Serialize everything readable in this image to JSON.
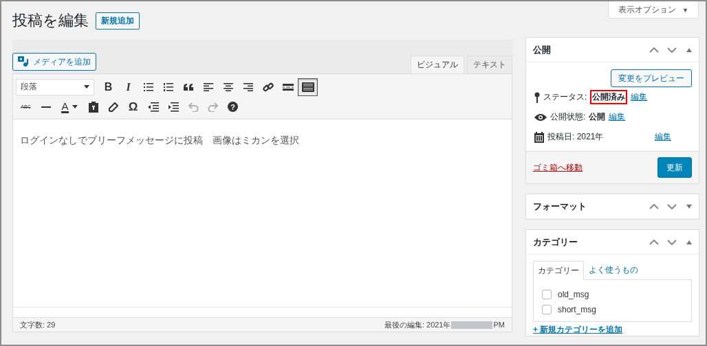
{
  "screen_options": {
    "label": "表示オプション",
    "caret": "▼"
  },
  "heading": {
    "title": "投稿を編集",
    "add_new": "新規追加"
  },
  "editor": {
    "add_media": "メディアを追加",
    "tabs": [
      {
        "label": "ビジュアル",
        "selected": true
      },
      {
        "label": "テキスト",
        "selected": false
      }
    ],
    "format_select": "段落",
    "toolbar_row_1": [
      {
        "kind": "bold",
        "glyph": "B",
        "on": false
      },
      {
        "kind": "italic",
        "glyph": "I",
        "on": false
      },
      {
        "kind": "bullets",
        "on": false
      },
      {
        "kind": "numbers",
        "on": false
      },
      {
        "kind": "quote",
        "on": false
      },
      {
        "kind": "align-left",
        "on": false
      },
      {
        "kind": "align-center",
        "on": false
      },
      {
        "kind": "align-right",
        "on": false
      },
      {
        "kind": "link",
        "on": false
      },
      {
        "kind": "more",
        "on": false
      },
      {
        "kind": "toolbar-toggle",
        "on": true
      }
    ],
    "toolbar_row_2": [
      {
        "kind": "strike",
        "glyph": "ABC",
        "disabled": false
      },
      {
        "kind": "hr",
        "disabled": false
      },
      {
        "kind": "text-color",
        "glyph": "A",
        "disabled": false
      },
      {
        "kind": "paste",
        "disabled": false
      },
      {
        "kind": "eraser",
        "disabled": false
      },
      {
        "kind": "omega",
        "glyph": "Ω",
        "disabled": false
      },
      {
        "kind": "outdent",
        "disabled": false
      },
      {
        "kind": "indent",
        "disabled": false
      },
      {
        "kind": "undo",
        "disabled": true
      },
      {
        "kind": "redo",
        "disabled": true
      },
      {
        "kind": "help",
        "glyph": "?",
        "disabled": false
      }
    ],
    "content": "ログインなしでブリーフメッセージに投稿　画像はミカンを選択",
    "word_count": "文字数: 29",
    "last_edit": "最後の編集: 2021年",
    "last_edit_suffix": "PM"
  },
  "publish_box": {
    "title": "公開",
    "expanded": true,
    "preview": "変更をプレビュー",
    "status_label": "ステータス:",
    "status_value": "公開済み",
    "status_highlighted": true,
    "status_edit": "編集",
    "visibility_label": "公開状態:",
    "visibility_value": "公開",
    "visibility_edit": "編集",
    "date_label": "投稿日: 2021年",
    "date_edit": "編集",
    "trash": "ゴミ箱へ移動",
    "update": "更新"
  },
  "format_box": {
    "title": "フォーマット",
    "expanded": false
  },
  "category_box": {
    "title": "カテゴリー",
    "expanded": true,
    "tabs": [
      {
        "label": "カテゴリー",
        "selected": true
      },
      {
        "label": "よく使うもの",
        "selected": false
      }
    ],
    "categories": [
      {
        "name": "old_msg",
        "checked": false
      },
      {
        "name": "short_msg",
        "checked": false
      }
    ],
    "add_new": "+ 新規カテゴリーを追加"
  }
}
